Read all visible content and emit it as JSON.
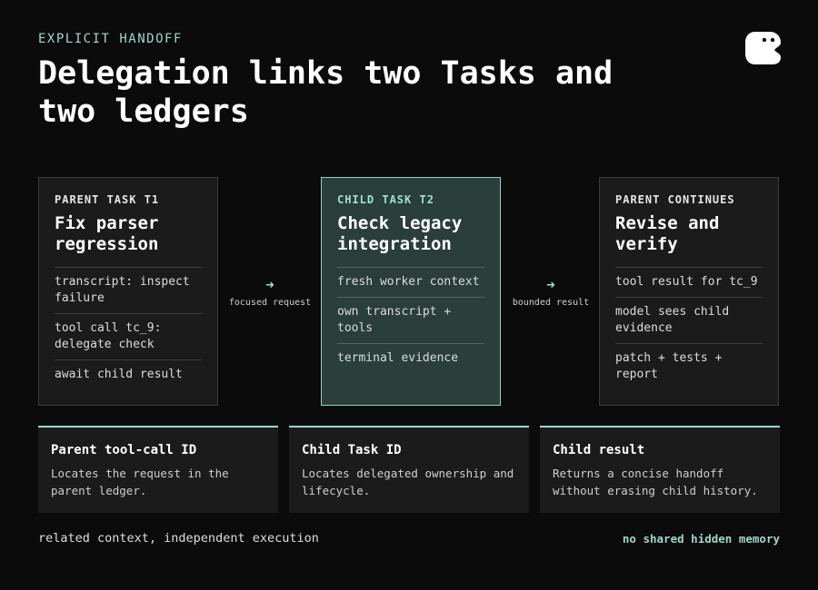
{
  "header": {
    "eyebrow": "EXPLICIT HANDOFF",
    "title": "Delegation links two Tasks and two ledgers"
  },
  "colors": {
    "background": "#0b0b0b",
    "accent": "#9fd6cc",
    "card": "#1b1b1b",
    "active_card": "#2a3e3a"
  },
  "cards": [
    {
      "kicker": "PARENT TASK T1",
      "title": "Fix parser regression",
      "items": [
        "transcript: inspect failure",
        "tool call tc_9: delegate check",
        "await child result"
      ]
    },
    {
      "kicker": "CHILD TASK T2",
      "title": "Check legacy integration",
      "items": [
        "fresh worker context",
        "own transcript + tools",
        "terminal evidence"
      ]
    },
    {
      "kicker": "PARENT CONTINUES",
      "title": "Revise and verify",
      "items": [
        "tool result for tc_9",
        "model sees child evidence",
        "patch + tests + report"
      ]
    }
  ],
  "connectors": [
    {
      "arrow": "➜",
      "label": "focused request"
    },
    {
      "arrow": "➜",
      "label": "bounded result"
    }
  ],
  "info": [
    {
      "title": "Parent tool-call ID",
      "body": "Locates the request in the parent ledger."
    },
    {
      "title": "Child Task ID",
      "body": "Locates delegated ownership and lifecycle."
    },
    {
      "title": "Child result",
      "body": "Returns a concise handoff without erasing child history."
    }
  ],
  "footer": {
    "left": "related context, independent execution",
    "right": "no shared hidden memory"
  }
}
